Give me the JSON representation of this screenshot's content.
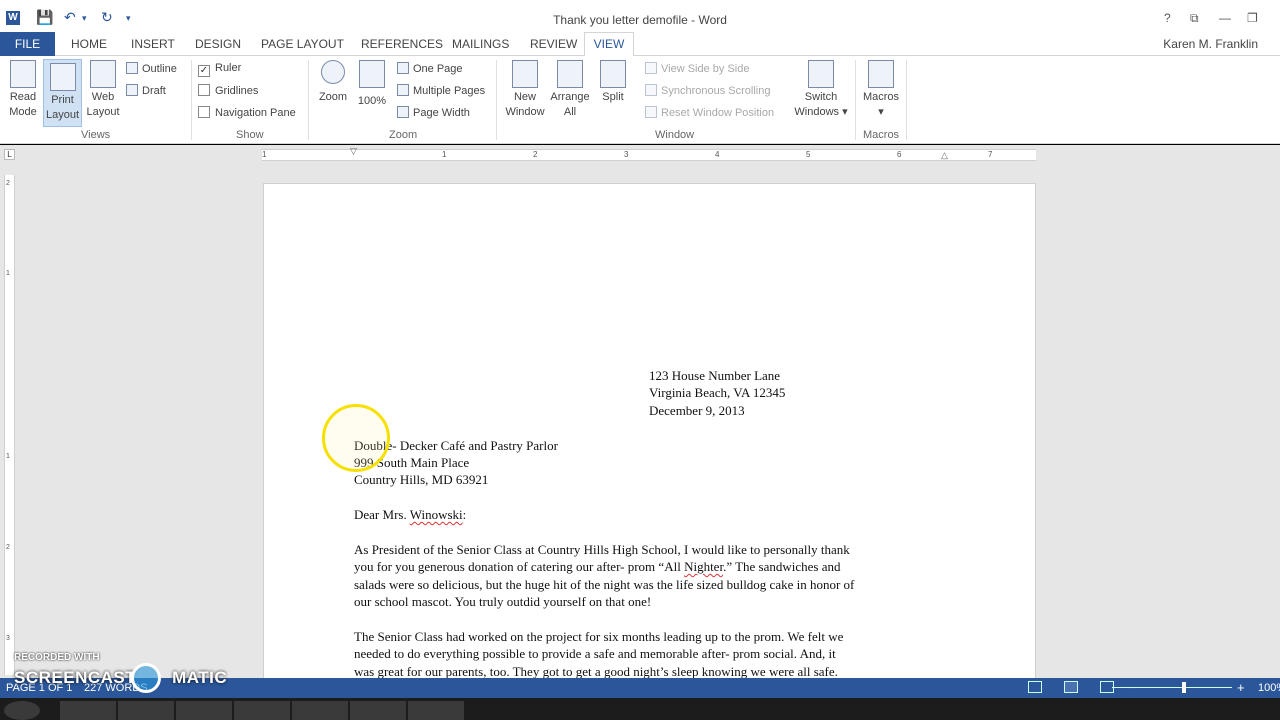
{
  "window": {
    "title": "Thank you letter demofile - Word",
    "app_icon": "W",
    "qat_icons": [
      "save-icon",
      "undo-icon",
      "redo-icon",
      "customize-icon"
    ],
    "controls": [
      "?",
      "⧉",
      "—",
      "❐"
    ]
  },
  "tabs": {
    "file": "FILE",
    "items": [
      "HOME",
      "INSERT",
      "DESIGN",
      "PAGE LAYOUT",
      "REFERENCES",
      "MAILINGS",
      "REVIEW"
    ],
    "active": "VIEW",
    "user": "Karen M. Franklin"
  },
  "ribbon": {
    "views": {
      "label": "Views",
      "read_mode": [
        "Read",
        "Mode"
      ],
      "print_layout": [
        "Print",
        "Layout"
      ],
      "web_layout": [
        "Web",
        "Layout"
      ],
      "outline": "Outline",
      "draft": "Draft"
    },
    "show": {
      "label": "Show",
      "ruler": "Ruler",
      "ruler_checked": true,
      "gridlines": "Gridlines",
      "navigation_pane": "Navigation Pane"
    },
    "zoom": {
      "label": "Zoom",
      "zoom": "Zoom",
      "hundred": "100%",
      "one_page": "One Page",
      "multiple_pages": "Multiple Pages",
      "page_width": "Page Width"
    },
    "window": {
      "label": "Window",
      "new_window": [
        "New",
        "Window"
      ],
      "arrange_all": [
        "Arrange",
        "All"
      ],
      "split": "Split",
      "side_by_side": "View Side by Side",
      "sync_scrolling": "Synchronous Scrolling",
      "reset_position": "Reset Window Position",
      "switch_windows": [
        "Switch",
        "Windows ▾"
      ]
    },
    "macros": {
      "label": "Macros",
      "macros": "Macros",
      "macros_arrow": "▾"
    }
  },
  "ruler": {
    "h_numbers": [
      "1",
      "1",
      "2",
      "3",
      "4",
      "5",
      "6",
      "7"
    ],
    "v_numbers": [
      "2",
      "1",
      "1",
      "2",
      "3"
    ],
    "tab_selector": "L"
  },
  "document": {
    "sender": [
      "123 House Number Lane",
      "Virginia Beach, VA 12345",
      "December 9, 2013"
    ],
    "recipient": [
      "Double- Decker Café and Pastry Parlor",
      "999 South Main Place",
      "Country Hills, MD 63921"
    ],
    "salutation_pre": "Dear Mrs. ",
    "salutation_name": "Winowski",
    "salutation_post": ":",
    "para1": [
      "As President of the Senior Class at Country Hills High School, I would like to personally thank",
      "you for you generous donation of catering our after- prom “All ",
      "salads were so delicious, but the huge hit of the night was the life sized bulldog cake in honor of",
      "our school mascot. You truly outdid yourself on that one!"
    ],
    "para1_line2_squig": "Nighter",
    "para1_line2_end": ".” The sandwiches and",
    "para2": [
      "The Senior Class had worked on the project for six months leading up to the prom.  We felt we",
      "needed to do everything possible to provide a safe and memorable after- prom social.  And, it",
      "was great for our parents, too.  They got to get a good night’s sleep knowing we were all safe."
    ]
  },
  "status": {
    "page": "PAGE 1 OF 1",
    "words": "227 WORDS",
    "zoom_minus": "−",
    "zoom_plus": "+",
    "zoom": "100%",
    "zoom_level": 0.6
  },
  "watermark": {
    "line1": "RECORDED WITH",
    "line2": "SCREENCAST",
    "line3": "MATIC"
  }
}
